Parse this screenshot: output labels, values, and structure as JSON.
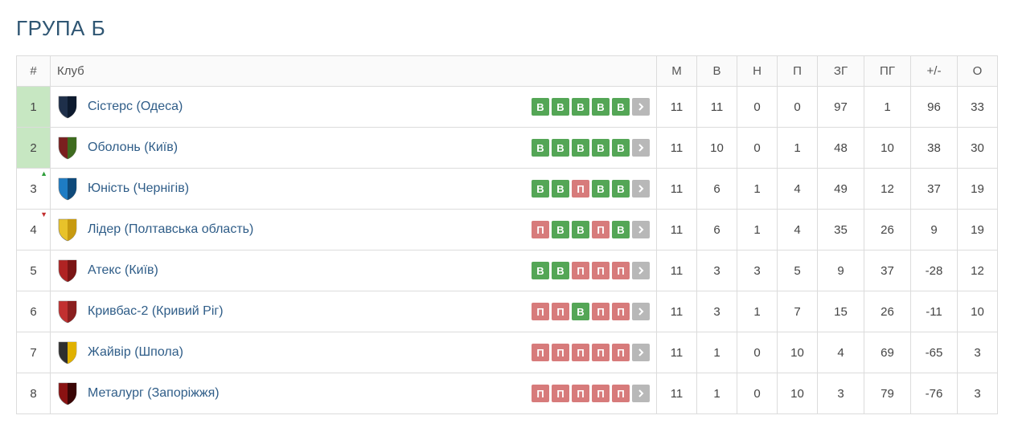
{
  "title": "ГРУПА Б",
  "columns": {
    "rank": "#",
    "club": "Клуб",
    "m": "М",
    "w": "В",
    "d": "Н",
    "l": "П",
    "gf": "ЗГ",
    "ga": "ПГ",
    "gd": "+/-",
    "pts": "О"
  },
  "form_labels": {
    "W": "В",
    "D": "Н",
    "L": "П"
  },
  "crest_colors": [
    [
      "#1e2f4a",
      "#0d1a2e"
    ],
    [
      "#7a1f1f",
      "#3e6b1f"
    ],
    [
      "#1e7cc4",
      "#0f4a7a"
    ],
    [
      "#e8c22a",
      "#c79a10"
    ],
    [
      "#b02323",
      "#7a1515"
    ],
    [
      "#c23030",
      "#8a1f1f"
    ],
    [
      "#2e2e2e",
      "#e0b100"
    ],
    [
      "#8a1212",
      "#3a0505"
    ]
  ],
  "rows": [
    {
      "rank": 1,
      "promo": true,
      "move": "",
      "club": "Сістерс (Одеса)",
      "form": [
        "W",
        "W",
        "W",
        "W",
        "W"
      ],
      "m": 11,
      "w": 11,
      "d": 0,
      "l": 0,
      "gf": 97,
      "ga": 1,
      "gd": 96,
      "pts": 33
    },
    {
      "rank": 2,
      "promo": true,
      "move": "",
      "club": "Оболонь (Київ)",
      "form": [
        "W",
        "W",
        "W",
        "W",
        "W"
      ],
      "m": 11,
      "w": 10,
      "d": 0,
      "l": 1,
      "gf": 48,
      "ga": 10,
      "gd": 38,
      "pts": 30
    },
    {
      "rank": 3,
      "promo": false,
      "move": "up",
      "club": "Юність (Чернігів)",
      "form": [
        "W",
        "W",
        "L",
        "W",
        "W"
      ],
      "m": 11,
      "w": 6,
      "d": 1,
      "l": 4,
      "gf": 49,
      "ga": 12,
      "gd": 37,
      "pts": 19
    },
    {
      "rank": 4,
      "promo": false,
      "move": "down",
      "club": "Лідер (Полтавська область)",
      "form": [
        "L",
        "W",
        "W",
        "L",
        "W"
      ],
      "m": 11,
      "w": 6,
      "d": 1,
      "l": 4,
      "gf": 35,
      "ga": 26,
      "gd": 9,
      "pts": 19
    },
    {
      "rank": 5,
      "promo": false,
      "move": "",
      "club": "Атекс (Київ)",
      "form": [
        "W",
        "W",
        "L",
        "L",
        "L"
      ],
      "m": 11,
      "w": 3,
      "d": 3,
      "l": 5,
      "gf": 9,
      "ga": 37,
      "gd": -28,
      "pts": 12
    },
    {
      "rank": 6,
      "promo": false,
      "move": "",
      "club": "Кривбас-2 (Кривий Ріг)",
      "form": [
        "L",
        "L",
        "W",
        "L",
        "L"
      ],
      "m": 11,
      "w": 3,
      "d": 1,
      "l": 7,
      "gf": 15,
      "ga": 26,
      "gd": -11,
      "pts": 10
    },
    {
      "rank": 7,
      "promo": false,
      "move": "",
      "club": "Жайвір (Шпола)",
      "form": [
        "L",
        "L",
        "L",
        "L",
        "L"
      ],
      "m": 11,
      "w": 1,
      "d": 0,
      "l": 10,
      "gf": 4,
      "ga": 69,
      "gd": -65,
      "pts": 3
    },
    {
      "rank": 8,
      "promo": false,
      "move": "",
      "club": "Металург (Запоріжжя)",
      "form": [
        "L",
        "L",
        "L",
        "L",
        "L"
      ],
      "m": 11,
      "w": 1,
      "d": 0,
      "l": 10,
      "gf": 3,
      "ga": 79,
      "gd": -76,
      "pts": 3
    }
  ]
}
